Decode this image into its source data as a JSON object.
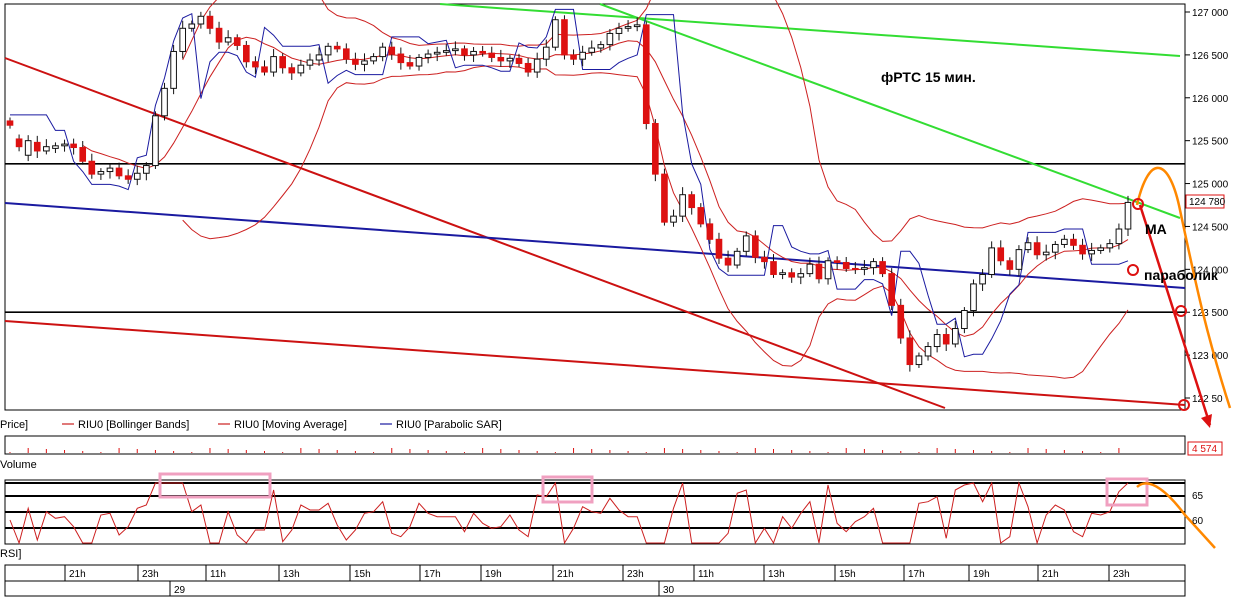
{
  "chart_data": {
    "type": "candlestick",
    "title": "фРТС   15 мин.",
    "price_axis": {
      "min": 122400,
      "max": 127070,
      "ticks": [
        127000,
        126500,
        126000,
        125500,
        125000,
        124500,
        124000,
        123500,
        123000,
        122500
      ],
      "tick_labels": [
        "127 000",
        "126 500",
        "126 000",
        "125 500",
        "125 000",
        "124 500",
        "124 000",
        "123 500",
        "123 000",
        "122 50"
      ],
      "last_price_label": "124 780",
      "last_price": 124780
    },
    "time_axis": {
      "labels": [
        "21h",
        "23h",
        "11h",
        "13h",
        "15h",
        "17h",
        "19h",
        "21h",
        "23h",
        "11h",
        "13h",
        "15h",
        "17h",
        "19h",
        "21h",
        "23h"
      ],
      "dates": [
        "29",
        "30"
      ]
    },
    "candles": [
      [
        125730,
        125680
      ],
      [
        125520,
        125430
      ],
      [
        125330,
        125500
      ],
      [
        125480,
        125380
      ],
      [
        125380,
        125430
      ],
      [
        125410,
        125440
      ],
      [
        125440,
        125460
      ],
      [
        125460,
        125420
      ],
      [
        125420,
        125260
      ],
      [
        125260,
        125110
      ],
      [
        125110,
        125140
      ],
      [
        125140,
        125180
      ],
      [
        125180,
        125090
      ],
      [
        125090,
        125050
      ],
      [
        125050,
        125120
      ],
      [
        125120,
        125210
      ],
      [
        125210,
        125790
      ],
      [
        125790,
        126110
      ],
      [
        126110,
        126540
      ],
      [
        126540,
        126810
      ],
      [
        126810,
        126860
      ],
      [
        126860,
        126950
      ],
      [
        126950,
        126810
      ],
      [
        126810,
        126650
      ],
      [
        126650,
        126700
      ],
      [
        126700,
        126610
      ],
      [
        126610,
        126420
      ],
      [
        126420,
        126360
      ],
      [
        126360,
        126300
      ],
      [
        126300,
        126480
      ],
      [
        126480,
        126350
      ],
      [
        126350,
        126290
      ],
      [
        126290,
        126380
      ],
      [
        126380,
        126440
      ],
      [
        126440,
        126500
      ],
      [
        126500,
        126600
      ],
      [
        126600,
        126570
      ],
      [
        126570,
        126450
      ],
      [
        126450,
        126390
      ],
      [
        126390,
        126430
      ],
      [
        126430,
        126480
      ],
      [
        126480,
        126590
      ],
      [
        126590,
        126510
      ],
      [
        126510,
        126410
      ],
      [
        126410,
        126370
      ],
      [
        126370,
        126470
      ],
      [
        126470,
        126510
      ],
      [
        126510,
        126530
      ],
      [
        126530,
        126550
      ],
      [
        126550,
        126570
      ],
      [
        126570,
        126500
      ],
      [
        126500,
        126540
      ],
      [
        126540,
        126520
      ],
      [
        126520,
        126470
      ],
      [
        126470,
        126430
      ],
      [
        126430,
        126460
      ],
      [
        126460,
        126400
      ],
      [
        126400,
        126300
      ],
      [
        126300,
        126450
      ],
      [
        126450,
        126590
      ],
      [
        126590,
        126910
      ],
      [
        126910,
        126500
      ],
      [
        126500,
        126450
      ],
      [
        126450,
        126530
      ],
      [
        126530,
        126580
      ],
      [
        126580,
        126620
      ],
      [
        126620,
        126750
      ],
      [
        126750,
        126810
      ],
      [
        126810,
        126830
      ],
      [
        126830,
        126850
      ],
      [
        126850,
        125700
      ],
      [
        125700,
        125110
      ],
      [
        125110,
        124550
      ],
      [
        124550,
        124620
      ],
      [
        124620,
        124870
      ],
      [
        124870,
        124720
      ],
      [
        124720,
        124530
      ],
      [
        124530,
        124350
      ],
      [
        124350,
        124130
      ],
      [
        124130,
        124050
      ],
      [
        124050,
        124210
      ],
      [
        124210,
        124390
      ],
      [
        124390,
        124140
      ],
      [
        124140,
        124090
      ],
      [
        124090,
        123940
      ],
      [
        123940,
        123960
      ],
      [
        123960,
        123910
      ],
      [
        123910,
        123950
      ],
      [
        123950,
        124060
      ],
      [
        124060,
        123890
      ],
      [
        123890,
        124100
      ],
      [
        124100,
        124080
      ],
      [
        124080,
        124010
      ],
      [
        124010,
        124000
      ],
      [
        124000,
        124020
      ],
      [
        124020,
        124090
      ],
      [
        124090,
        123950
      ],
      [
        123950,
        123580
      ],
      [
        123580,
        123200
      ],
      [
        123200,
        122890
      ],
      [
        122890,
        122990
      ],
      [
        122990,
        123100
      ],
      [
        123100,
        123240
      ],
      [
        123240,
        123130
      ],
      [
        123130,
        123310
      ],
      [
        123310,
        123520
      ],
      [
        123520,
        123830
      ],
      [
        123830,
        123940
      ],
      [
        123940,
        124250
      ],
      [
        124250,
        124100
      ],
      [
        124100,
        124000
      ],
      [
        124000,
        124230
      ],
      [
        124230,
        124310
      ],
      [
        124310,
        124170
      ],
      [
        124170,
        124200
      ],
      [
        124200,
        124290
      ],
      [
        124290,
        124350
      ],
      [
        124350,
        124280
      ],
      [
        124280,
        124180
      ],
      [
        124180,
        124220
      ],
      [
        124220,
        124250
      ],
      [
        124250,
        124300
      ],
      [
        124300,
        124470
      ],
      [
        124470,
        124780
      ]
    ],
    "indicators": {
      "bollinger": {
        "name": "RIU0 [Bollinger Bands]",
        "color": "#cc2020"
      },
      "moving_average": {
        "name": "RIU0 [Moving Average]",
        "color": "#cc2020",
        "annotation": "MA"
      },
      "parabolic_sar": {
        "name": "RIU0 [Parabolic SAR]",
        "color": "#1a1aa0",
        "annotation": "параболик"
      }
    },
    "volume_panel": {
      "label": "Volume",
      "value_label": "4 574"
    },
    "rsi_panel": {
      "label": "RSI]",
      "tick_labels": [
        "65",
        "60"
      ]
    }
  },
  "legend": {
    "price": "Price]",
    "bollinger": "RIU0 [Bollinger Bands]",
    "ma": "RIU0 [Moving Average]",
    "sar": "RIU0 [Parabolic SAR]"
  },
  "annotations": {
    "title": "фРТС   15 мин.",
    "ma": "MA",
    "parabolic": "параболик"
  },
  "colors": {
    "bull": "#ffffff",
    "bear": "#dd1111",
    "resistance_green": "#33dd33",
    "trend_red": "#cc1111",
    "trend_blue": "#1a1aa0",
    "forecast_orange": "#ff8800",
    "rsi_boxes": "#f0a0c0"
  }
}
